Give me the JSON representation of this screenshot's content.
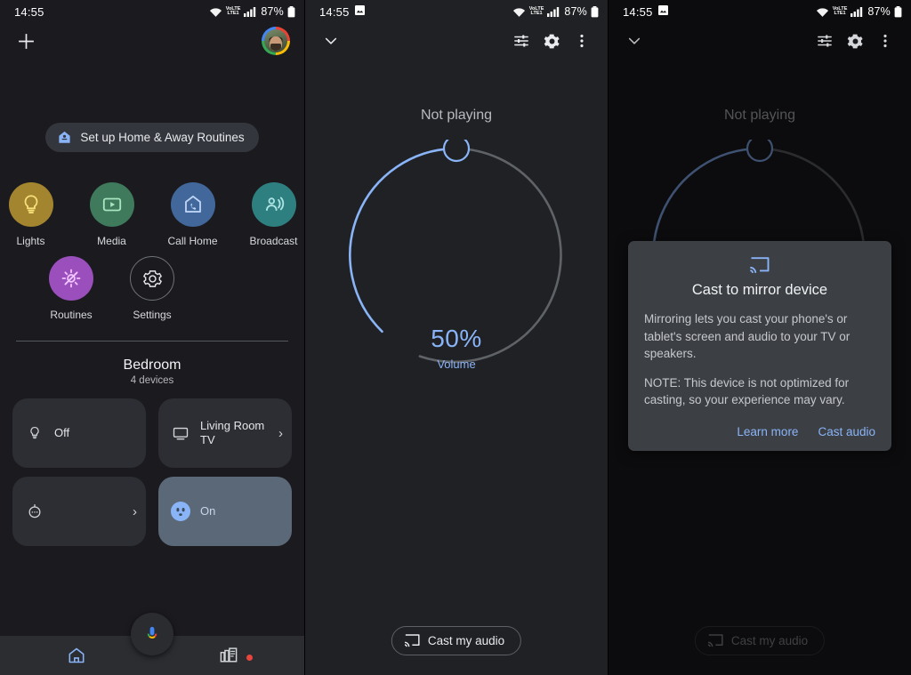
{
  "status_bar": {
    "time": "14:55",
    "screenshot_icon": "image-icon",
    "wifi_icon": "wifi-icon",
    "volte_label": "VoLTE",
    "network_label": "LTE1",
    "signal_icon": "signal-bars-icon",
    "battery_percent": "87%",
    "battery_icon": "battery-icon"
  },
  "home_panel": {
    "add_icon": "plus-icon",
    "avatar": "account-avatar",
    "chip": {
      "label": "Set up Home & Away Routines",
      "icon": "home-routine-icon",
      "color": "#8ab4f8"
    },
    "quick_actions": [
      {
        "label": "Lights",
        "icon": "lightbulb-icon",
        "bg": "#a3852f",
        "fg": "#f7e07a"
      },
      {
        "label": "Media",
        "icon": "play-box-icon",
        "bg": "#3e7a5b",
        "fg": "#a8e6c1"
      },
      {
        "label": "Call Home",
        "icon": "call-home-icon",
        "bg": "#41679b",
        "fg": "#bcd3f5"
      },
      {
        "label": "Broadcast",
        "icon": "broadcast-icon",
        "bg": "#2e7f80",
        "fg": "#aee3e4"
      },
      {
        "label": "Routines",
        "icon": "routines-icon",
        "bg": "#9a4fbd",
        "fg": "#f0c4ff"
      },
      {
        "label": "Settings",
        "icon": "gear-icon",
        "bg": "transparent",
        "fg": "#e4e6e9"
      }
    ],
    "room": {
      "title": "Bedroom",
      "subtitle": "4 devices"
    },
    "devices": [
      {
        "name": "light-tile",
        "icon": "lightbulb-icon",
        "label": "Off",
        "state": "off",
        "chevron": false
      },
      {
        "name": "tv-tile",
        "icon": "tv-icon",
        "label": "Living Room TV",
        "state": "off",
        "chevron": true
      },
      {
        "name": "speaker-tile",
        "icon": "speaker-icon",
        "label": "",
        "state": "off",
        "chevron": true
      },
      {
        "name": "smart-plug-tile",
        "icon": "outlet-icon",
        "label": "On",
        "state": "on",
        "chevron": false
      }
    ],
    "assistant_fab": "assistant-mic-icon",
    "nav": [
      {
        "name": "nav-home",
        "icon": "home-icon",
        "active": true,
        "badge": false
      },
      {
        "name": "nav-feed",
        "icon": "feed-icon",
        "active": false,
        "badge": true
      }
    ]
  },
  "volume_panel": {
    "collapse_icon": "chevron-down-icon",
    "tuner_icon": "equalizer-icon",
    "settings_icon": "gear-icon",
    "overflow_icon": "more-vert-icon",
    "now_playing": "Not playing",
    "volume_percent": "50%",
    "volume_label": "Volume",
    "volume_value": 50,
    "accent_color": "#8ab4f8",
    "track_color": "#5f6368",
    "cast_button": {
      "label": "Cast my audio",
      "icon": "cast-icon"
    }
  },
  "cast_panel": {
    "collapse_icon": "chevron-down-icon",
    "tuner_icon": "equalizer-icon",
    "settings_icon": "gear-icon",
    "overflow_icon": "more-vert-icon",
    "now_playing": "Not playing",
    "cast_button": {
      "label": "Cast my audio",
      "icon": "cast-icon"
    },
    "dialog": {
      "icon": "cast-icon",
      "title": "Cast to mirror device",
      "paragraph1": "Mirroring lets you cast your phone's or tablet's screen and audio to your TV or speakers.",
      "paragraph2": "NOTE: This device is not optimized for casting, so your experience may vary.",
      "learn_more": "Learn more",
      "cast_audio": "Cast audio"
    }
  }
}
